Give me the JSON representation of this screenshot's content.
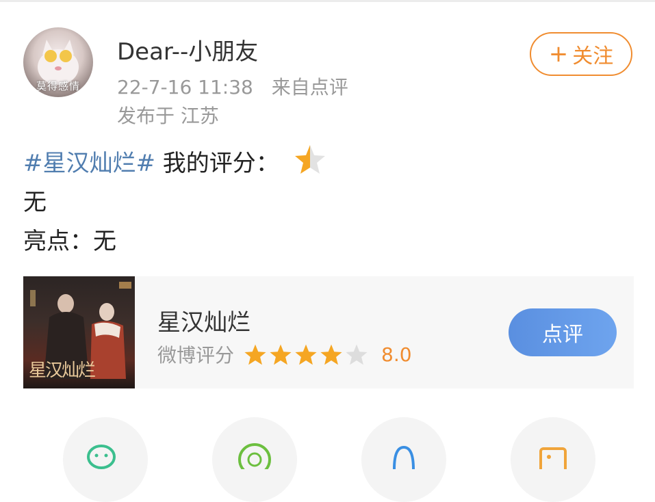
{
  "header": {
    "username": "Dear--小朋友",
    "avatar_text": "莫得感情",
    "datetime": "22-7-16 11:38",
    "source": "来自点评",
    "location": "发布于 江苏",
    "follow_label": "关注"
  },
  "post": {
    "hashtag": "#星汉灿烂#",
    "rating_label": "我的评分：",
    "rating_stars": 0.5,
    "line2": "无",
    "line3": "亮点：无"
  },
  "movie_card": {
    "poster_text": "星汉灿烂",
    "title": "星汉灿烂",
    "score_label": "微博评分",
    "stars_filled": 4,
    "stars_total": 5,
    "score": "8.0",
    "review_button": "点评"
  },
  "share": {
    "items": [
      "wechat-icon",
      "moments-icon",
      "qq-icon",
      "save-image-icon"
    ]
  },
  "colors": {
    "accent_orange": "#f08c2f",
    "hashtag_blue": "#507daf",
    "button_blue": "#5a8fe0",
    "star_gray": "#dddddd"
  }
}
